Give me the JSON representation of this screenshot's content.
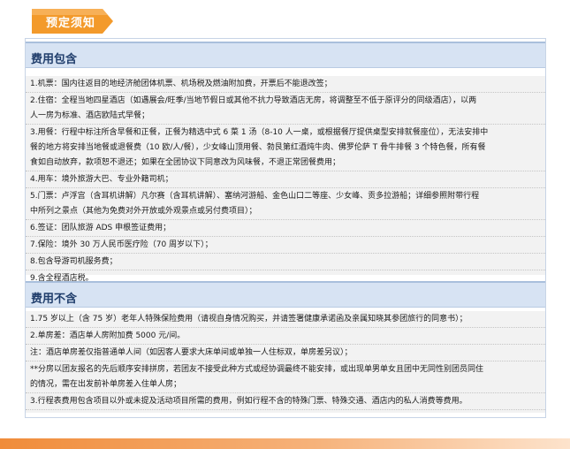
{
  "badge": {
    "label": "预定须知"
  },
  "included": {
    "title": "费用包含",
    "rows": [
      [
        "1.机票：国内往返目的地经济舱团体机票、机场税及燃油附加费，开票后不能退改签；"
      ],
      [
        "2.住宿：全程当地四星酒店（如遇展会/旺季/当地节假日或其他不抗力导致酒店无房，将调整至不低于原评分的同级酒店），以两",
        "人一房为标准、酒店欧陆式早餐；"
      ],
      [
        "3.用餐：行程中标注所含早餐和正餐，正餐为精选中式 6 菜 1 汤（8-10 人一桌，或根据餐厅提供桌型安排就餐座位），无法安排中",
        "餐的地方将安排当地餐或退餐费（10 欧/人/餐），少女峰山顶用餐、勃艮第红酒炖牛肉、佛罗伦萨 T 骨牛排餐 3 个特色餐，所有餐",
        "食如自动放弃，款项恕不退还；如果在全团协议下同意改为风味餐，不退正常团餐费用；"
      ],
      [
        "4.用车：境外旅游大巴、专业外籍司机；"
      ],
      [
        "5.门票：卢浮宫（含耳机讲解）凡尔赛（含耳机讲解）、塞纳河游船、金色山口二等座、少女峰、贡多拉游船；详细参照附带行程",
        "中所列之景点（其他为免费对外开放或外观景点或另付费项目）；"
      ],
      [
        "6.签证：团队旅游 ADS 申根签证费用；"
      ],
      [
        "7.保险：境外 30 万人民币医疗险（70 周岁以下）；"
      ],
      [
        "8.包含导游司机服务费；"
      ],
      [
        "9.含全程酒店税。"
      ]
    ]
  },
  "excluded": {
    "title": "费用不含",
    "rows": [
      [
        "1.75 岁以上（含 75 岁）老年人特殊保险费用（请视自身情况购买，并请签署健康承诺函及亲属知晓其参团旅行的同意书）；"
      ],
      [
        "2.单房差：酒店单人房附加费 5000 元/间。"
      ],
      [
        "注：酒店单房差仅指普通单人间（如因客人要求大床单间或单独一人住标双，单房差另议）；"
      ],
      [
        "**分房以团友报名的先后顺序安排拼房，若团友不接受此种方式或经协调最终不能安排，或出现单男单女且团中无同性别团员同住",
        "的情况，需在出发前补单房差入住单人房；"
      ],
      [
        "3.行程表费用包含项目以外或未提及活动项目所需的费用，例如行程不含的特殊门票、特殊交通、酒店内的私人消费等费用。"
      ]
    ]
  },
  "colors": {
    "badge": "#f39a2b",
    "header_bg": "#d7e3f3",
    "header_text": "#1f3d6b",
    "content_bg": "#f2f2f2",
    "footer_strip": "#f08c3a"
  }
}
